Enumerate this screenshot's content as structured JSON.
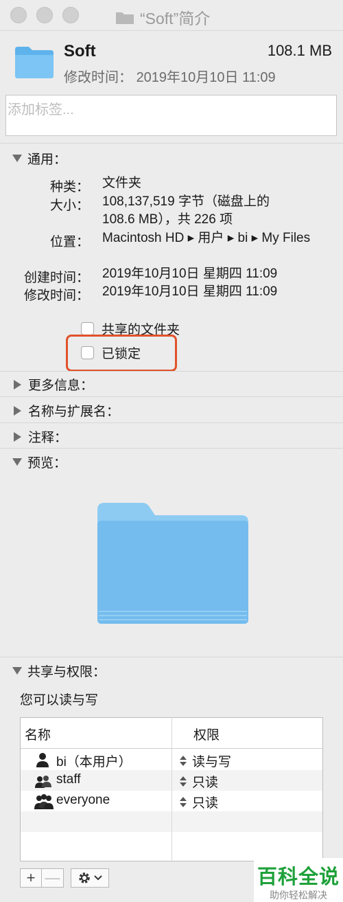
{
  "window": {
    "title": "“Soft”简介"
  },
  "header": {
    "name": "Soft",
    "size": "108.1 MB",
    "modified_label": "修改时间：",
    "modified_value": "2019年10月10日 11:09"
  },
  "tags": {
    "placeholder": "添加标签..."
  },
  "general": {
    "heading": "通用：",
    "rows": [
      {
        "label": "种类：",
        "value": "文件夹"
      },
      {
        "label": "大小：",
        "value": "108,137,519 字节（磁盘上的 108.6 MB），共 226 项"
      },
      {
        "label": "位置：",
        "value": "Macintosh HD ▸ 用户 ▸ bi ▸ My Files"
      },
      {
        "label": "创建时间：",
        "value": "2019年10月10日 星期四 11:09"
      },
      {
        "label": "修改时间：",
        "value": "2019年10月10日 星期四 11:09"
      }
    ],
    "shared_folder": "共享的文件夹",
    "locked": "已锁定"
  },
  "sections": {
    "more_info": "更多信息：",
    "name_ext": "名称与扩展名：",
    "comments": "注释：",
    "preview": "预览："
  },
  "sharing": {
    "heading": "共享与权限：",
    "can_read": "您可以读与写",
    "col_name": "名称",
    "col_priv": "权限",
    "rows": [
      {
        "name": "bi（本用户）",
        "priv": "读与写"
      },
      {
        "name": "staff",
        "priv": "只读"
      },
      {
        "name": "everyone",
        "priv": "只读"
      }
    ]
  },
  "watermark": {
    "line1": "百科全说",
    "line2": "助你轻松解决"
  },
  "colors": {
    "folder_blue": "#7cc5f5",
    "highlight": "#e0522a",
    "watermark_green": "#1ea13a"
  }
}
